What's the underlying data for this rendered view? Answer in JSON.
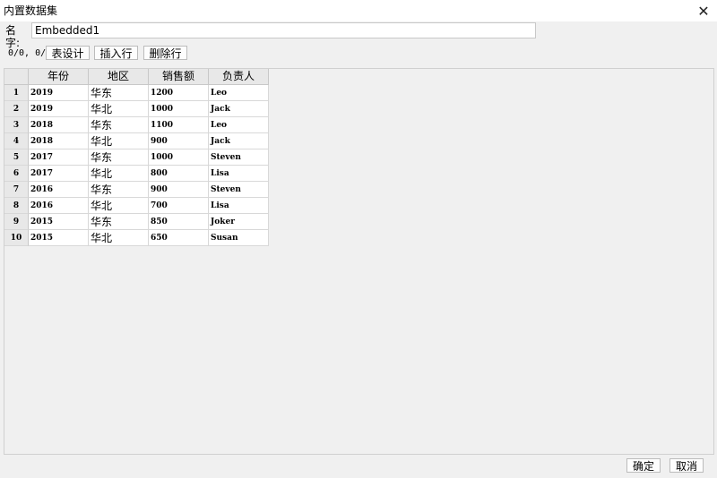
{
  "window": {
    "title": "内置数据集",
    "close_symbol": "✕"
  },
  "name_field": {
    "label": "名字:",
    "value": "Embedded1"
  },
  "toolbar": {
    "counter": "0/0, 0/0",
    "table_design": "表设计",
    "insert_row": "插入行",
    "delete_row": "删除行"
  },
  "table": {
    "columns": [
      "年份",
      "地区",
      "销售额",
      "负责人"
    ],
    "rows": [
      {
        "num": "1",
        "year": "2019",
        "region": "华东",
        "sales": "1200",
        "owner": "Leo"
      },
      {
        "num": "2",
        "year": "2019",
        "region": "华北",
        "sales": "1000",
        "owner": "Jack"
      },
      {
        "num": "3",
        "year": "2018",
        "region": "华东",
        "sales": "1100",
        "owner": "Leo"
      },
      {
        "num": "4",
        "year": "2018",
        "region": "华北",
        "sales": "900",
        "owner": "Jack"
      },
      {
        "num": "5",
        "year": "2017",
        "region": "华东",
        "sales": "1000",
        "owner": "Steven"
      },
      {
        "num": "6",
        "year": "2017",
        "region": "华北",
        "sales": "800",
        "owner": "Lisa"
      },
      {
        "num": "7",
        "year": "2016",
        "region": "华东",
        "sales": "900",
        "owner": "Steven"
      },
      {
        "num": "8",
        "year": "2016",
        "region": "华北",
        "sales": "700",
        "owner": "Lisa"
      },
      {
        "num": "9",
        "year": "2015",
        "region": "华东",
        "sales": "850",
        "owner": "Joker"
      },
      {
        "num": "10",
        "year": "2015",
        "region": "华北",
        "sales": "650",
        "owner": "Susan"
      }
    ]
  },
  "footer": {
    "ok": "确定",
    "cancel": "取消"
  }
}
